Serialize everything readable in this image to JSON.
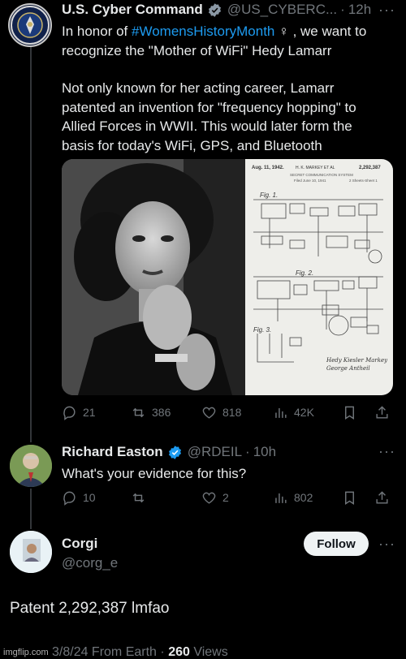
{
  "tweet1": {
    "name": "U.S. Cyber Command",
    "handle": "@US_CYBERC...",
    "time": "12h",
    "line1_prefix": "In honor of ",
    "line1_hashtag": "#WomensHistoryMonth",
    "line1_suffix": " ♀ , we want to",
    "line2": "recognize the \"Mother of WiFi\" Hedy Lamarr",
    "para2_line1": "Not only known for her acting career, Lamarr",
    "para2_line2": "patented an invention for \"frequency hopping\" to",
    "para2_line3": "Allied Forces in WWII. This would later form the",
    "para2_line4": "basis for today's WiFi, GPS, and Bluetooth",
    "patent_date": "Aug. 11, 1942.",
    "patent_inventors": "H. K. MARKEY ET AL",
    "patent_number": "2,292,387",
    "patent_title": "SECRET COMMUNICATION SYSTEM",
    "patent_filed": "Filed June 10, 1941",
    "patent_sheets": "2 Sheets-Sheet 1",
    "fig1": "Fig. 1.",
    "fig2": "Fig. 2.",
    "fig3": "Fig. 3.",
    "replies": "21",
    "reposts": "386",
    "likes": "818",
    "views": "42K"
  },
  "tweet2": {
    "name": "Richard Easton",
    "handle": "@RDEIL",
    "time": "10h",
    "text": "What's your evidence for this?",
    "replies": "10",
    "reposts": "",
    "likes": "2",
    "views": "802"
  },
  "tweet3": {
    "name": "Corgi",
    "handle": "@corg_e",
    "follow_label": "Follow",
    "text": "Patent 2,292,387 lmfao",
    "time": "3/8/24 From Earth",
    "views_count": "260",
    "views_label": "Views"
  },
  "watermark": "imgflip.com",
  "colors": {
    "background": "#000000",
    "text": "#e7e9ea",
    "muted": "#71767b",
    "accent": "#1d9bf0",
    "verified": "#1d9bf0"
  }
}
